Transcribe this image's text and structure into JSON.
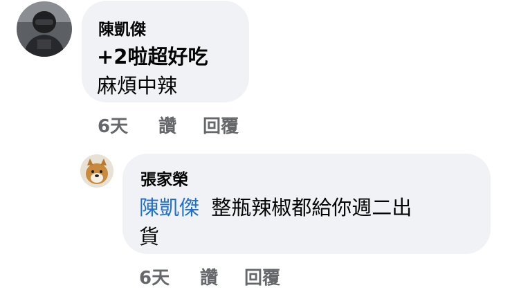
{
  "comments": [
    {
      "author": "陳凱傑",
      "text_lines": [
        "+2啦超好吃",
        "麻煩中辣"
      ],
      "time": "6天",
      "like_label": "讚",
      "reply_label": "回覆"
    },
    {
      "author": "張家榮",
      "mention": "陳凱傑",
      "text_line1": "整瓶辣椒都給你週二出",
      "text_line2": "貨",
      "time": "6天",
      "like_label": "讚",
      "reply_label": "回覆"
    }
  ],
  "colors": {
    "bubble": "#f0f2f5",
    "mention": "#1f6fd1",
    "meta": "#65676b",
    "text": "#050505"
  }
}
